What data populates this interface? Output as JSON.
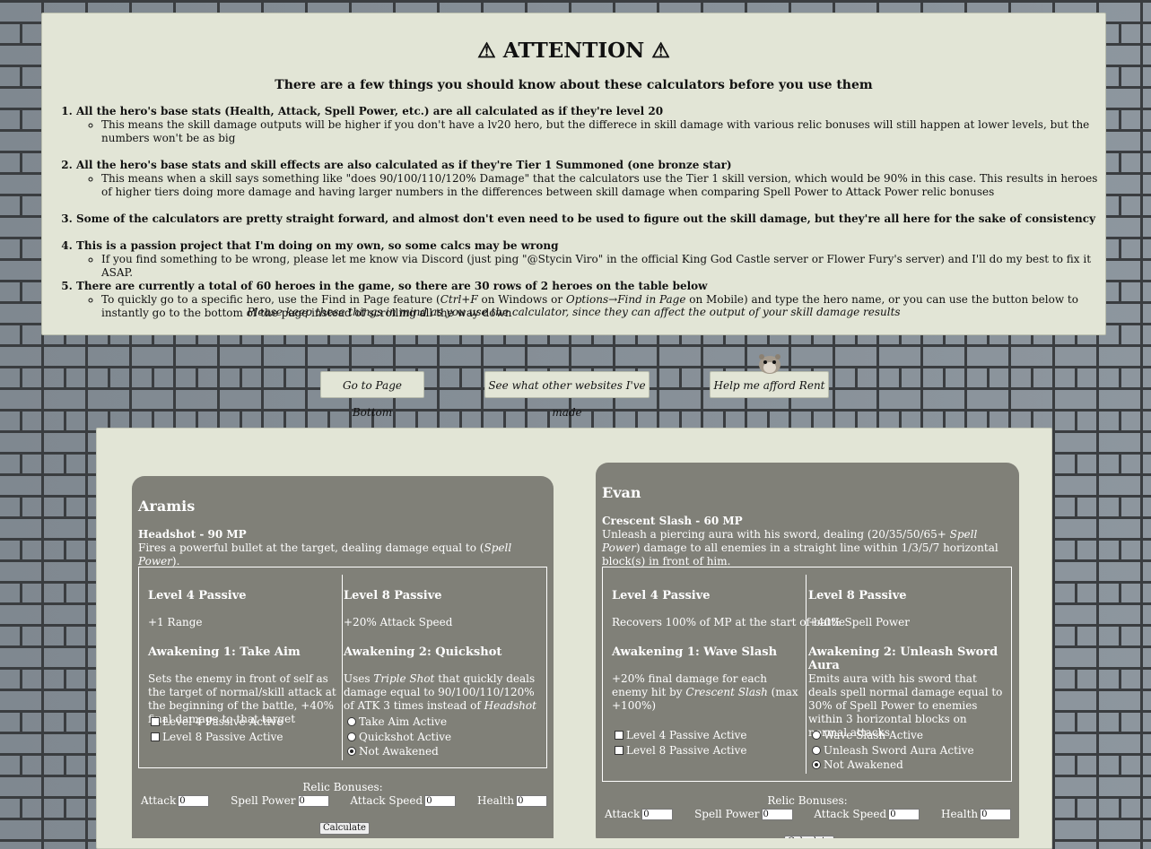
{
  "notice": {
    "title": "⚠ ATTENTION ⚠",
    "subtitle": "There are a few things you should know about these calculators before you use them",
    "items": [
      {
        "text": "All the hero's base stats (Health, Attack, Spell Power, etc.) are all calculated as if they're level 20",
        "sub": "This means the skill damage outputs will be higher if you don't have a lv20 hero, but the differece in skill damage with various relic bonuses will still happen at lower levels, but the numbers won't be as big"
      },
      {
        "text": "All the hero's base stats and skill effects are also calculated as if they're Tier 1 Summoned (one bronze star)",
        "sub": "This means when a skill says something like \"does 90/100/110/120% Damage\" that the calculators use the Tier 1 skill version, which would be 90% in this case. This results in heroes of higher tiers doing more damage and having larger numbers in the differences between skill damage when comparing Spell Power to Attack Power relic bonuses"
      },
      {
        "text": "Some of the calculators are pretty straight forward, and almost don't even need to be used to figure out the skill damage, but they're all here for the sake of consistency"
      },
      {
        "text": "This is a passion project that I'm doing on my own, so some calcs may be wrong",
        "sub": "If you find something to be wrong, please let me know via Discord (just ping \"@Stycin Viro\" in the official King God Castle server or Flower Fury's server) and I'll do my best to fix it ASAP."
      },
      {
        "text": "There are currently a total of 60 heroes in the game, so there are 30 rows of 2 heroes on the table below",
        "sub_a": "To quickly go to a specific hero, use the Find in Page feature (",
        "sub_b": "Ctrl+F",
        "sub_c": " on Windows or ",
        "sub_d": "Options→Find in Page",
        "sub_e": " on Mobile) and type the hero name, or you can use the button below to instantly go to the bottom of the page instead of scrolling all the way down"
      }
    ],
    "footer": "Please keep these things in mind as you use the calculator, since they can affect the output of your skill damage results"
  },
  "buttons": {
    "bottom": "Go to Page Bottom",
    "websites": "See what other websites I've made",
    "rent": "Help me afford Rent"
  },
  "relic_labels": {
    "heading": "Relic Bonuses:",
    "attack": "Attack",
    "spell_power": "Spell Power",
    "attack_speed": "Attack Speed",
    "health": "Health",
    "default_value": "0",
    "calculate": "Calculate"
  },
  "heroes": [
    {
      "name": "Aramis",
      "skill_title": "Headshot - 90 MP",
      "skill_desc_a": "Fires a powerful bullet at the target, dealing damage equal to (",
      "skill_desc_b": "Spell Power",
      "skill_desc_c": ").",
      "lv4_title": "Level 4 Passive",
      "lv4_text": "+1 Range",
      "lv8_title": "Level 8 Passive",
      "lv8_text": "+20% Attack Speed",
      "aw1_title": "Awakening 1: Take Aim",
      "aw1_text": "Sets the enemy in front of self as the target of normal/skill attack at the beginning of the battle, +40% final damage to that target",
      "aw2_title": "Awakening 2: Quickshot",
      "aw2_a": "Uses ",
      "aw2_b": "Triple Shot",
      "aw2_c": " that quickly deals damage equal to 90/100/110/120% of ATK 3 times instead of ",
      "aw2_d": "Headshot",
      "chk1": "Level 4 Passive Active",
      "chk2": "Level 8 Passive Active",
      "rad1": "Take Aim Active",
      "rad2": "Quickshot Active",
      "rad3": "Not Awakened"
    },
    {
      "name": "Evan",
      "skill_title": "Crescent Slash - 60 MP",
      "skill_desc_a": "Unleash a piercing aura with his sword, dealing (20/35/50/65+ ",
      "skill_desc_b": "Spell Power",
      "skill_desc_c": ") damage to all enemies in a straight line within 1/3/5/7 horizontal block(s) in front of him.",
      "lv4_title": "Level 4 Passive",
      "lv4_text": "Recovers 100% of MP at the start of battle",
      "lv8_title": "Level 8 Passive",
      "lv8_text": "+40% Spell Power",
      "aw1_title": "Awakening 1: Wave Slash",
      "aw1_a": "+20% final damage for each enemy hit by ",
      "aw1_b": "Crescent Slash",
      "aw1_c": " (max +100%)",
      "aw2_title": "Awakening 2: Unleash Sword Aura",
      "aw2_text": "Emits aura with his sword that deals spell normal damage equal to 30% of Spell Power to enemies within 3 horizontal blocks on normal attacks",
      "chk1": "Level 4 Passive Active",
      "chk2": "Level 8 Passive Active",
      "rad1": "Wave Slash Active",
      "rad2": "Unleash Sword Aura Active",
      "rad3": "Not Awakened"
    }
  ]
}
